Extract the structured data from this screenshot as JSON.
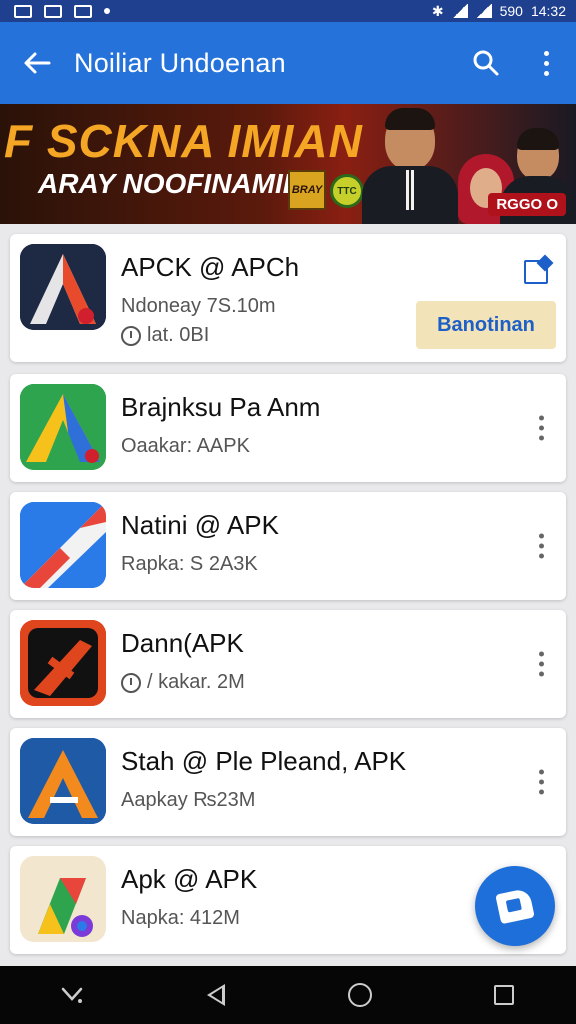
{
  "status_bar": {
    "right_text": "590",
    "time": "14:32"
  },
  "app_bar": {
    "title": "Noiliar Undoenan"
  },
  "banner": {
    "title": "F SCKNA IMIAN",
    "subtitle": "ARAY NOOFINAMIE",
    "badge1": "BRAY",
    "badge2": "TTC",
    "tag": "RGGO O"
  },
  "apps": [
    {
      "name": "APCK @ APCh",
      "meta": "Ndoneay 7S.10m",
      "meta2": "lat. 0BI",
      "action": "Banotinan"
    },
    {
      "name": "Brajnksu Pa Anm",
      "meta": "Oaakar: AAPK"
    },
    {
      "name": "Natini @ APK",
      "meta": "Rapka: S 2A3K"
    },
    {
      "name": "Dann(APK",
      "meta": "/ kakar. 2M"
    },
    {
      "name": "Stah @ Ple Pleand, APK",
      "meta": "Aapkay ₨23M"
    },
    {
      "name": "Apk @ APK",
      "meta": "Napka: 412M"
    }
  ],
  "icons": {
    "back": "arrow-left-icon",
    "search": "search-icon",
    "more": "more-vertical-icon",
    "share": "open-in-new-icon",
    "fab": "edit-icon",
    "nav_recent": "down-arrow-icon",
    "nav_back": "back-triangle-icon",
    "nav_home": "home-circle-icon",
    "nav_overview": "overview-square-icon"
  },
  "colors": {
    "app_bar": "#2572db",
    "status_bar": "#1f3f8f",
    "accent": "#1e6fd9",
    "download_bg": "#f3e3b8"
  }
}
